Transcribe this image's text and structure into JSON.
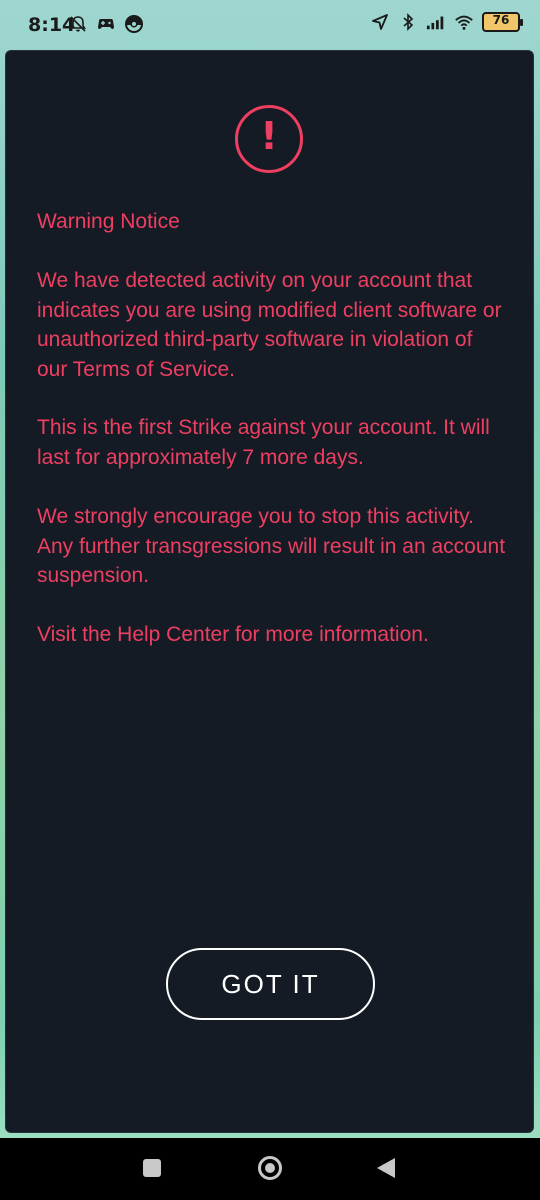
{
  "status_bar": {
    "time": "8:14",
    "battery_level": "76",
    "left_icons": [
      "bell-off-icon",
      "gamepad-icon",
      "pokeball-icon"
    ],
    "right_icons": [
      "location-arrow-icon",
      "bluetooth-icon",
      "signal-icon",
      "wifi-icon",
      "battery-icon"
    ]
  },
  "dialog": {
    "warning_symbol": "!",
    "title": "Warning Notice",
    "paragraph_1": "We have detected activity on your account that indicates you are using modified client software or unauthorized third-party software in violation of our  Terms of Service.",
    "paragraph_2": "This is the first Strike against your account. It will last for approximately 7 more days.",
    "paragraph_3": "We strongly encourage you to stop this activity. Any further transgressions will result in an account suspension.",
    "paragraph_4": "Visit the Help Center  for more information.",
    "button_label": "GOT IT"
  },
  "colors": {
    "accent": "#ee3f62",
    "dialog_background": "#151b24",
    "button_border": "#ffffff"
  },
  "nav_bar": {
    "icons": [
      "recents-square-icon",
      "home-circle-icon",
      "back-triangle-icon"
    ]
  }
}
